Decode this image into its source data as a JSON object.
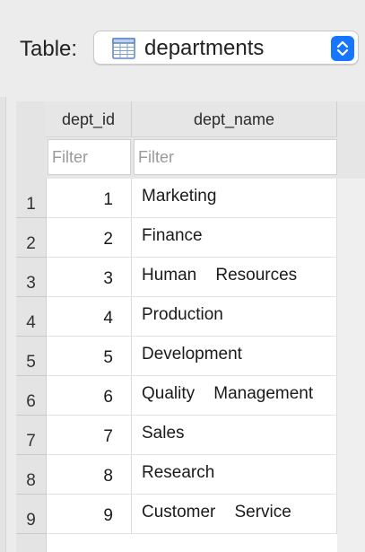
{
  "toolbar": {
    "table_label": "Table:",
    "selected_table": "departments"
  },
  "colors": {
    "accent": "#1676ff",
    "filter_placeholder": "#9a9a9a"
  },
  "grid": {
    "columns": [
      {
        "label": "dept_id",
        "filter_placeholder": "Filter"
      },
      {
        "label": "dept_name",
        "filter_placeholder": "Filter"
      }
    ],
    "rows": [
      {
        "num": "1",
        "dept_id": "1",
        "dept_name": "Marketing"
      },
      {
        "num": "2",
        "dept_id": "2",
        "dept_name": "Finance"
      },
      {
        "num": "3",
        "dept_id": "3",
        "dept_name": "Human    Resources"
      },
      {
        "num": "4",
        "dept_id": "4",
        "dept_name": "Production"
      },
      {
        "num": "5",
        "dept_id": "5",
        "dept_name": "Development"
      },
      {
        "num": "6",
        "dept_id": "6",
        "dept_name": "Quality    Management"
      },
      {
        "num": "7",
        "dept_id": "7",
        "dept_name": "Sales"
      },
      {
        "num": "8",
        "dept_id": "8",
        "dept_name": "Research"
      },
      {
        "num": "9",
        "dept_id": "9",
        "dept_name": "Customer    Service"
      }
    ]
  },
  "icons": {
    "table_selector": "table-icon",
    "stepper": "up-down-stepper-icon"
  }
}
